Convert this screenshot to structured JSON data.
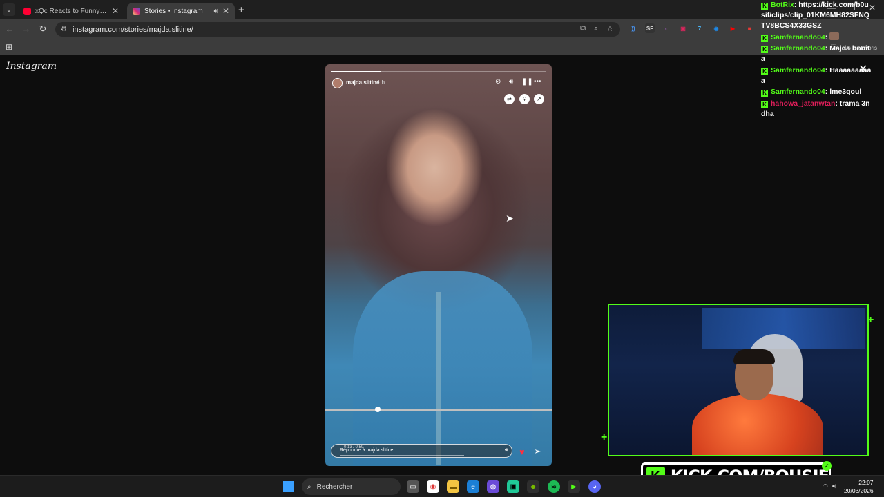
{
  "browser": {
    "tabs": [
      {
        "title": "xQc Reacts to Funny TikToks fo",
        "favicon_color": "#ff0033",
        "active": false
      },
      {
        "title": "Stories • Instagram",
        "favicon_color": "#d62976",
        "active": true
      }
    ],
    "url": "instagram.com/stories/majda.slitine/",
    "bookmarks_folder": "Tous les favoris",
    "extensions": [
      {
        "glyph": "))",
        "color": "#4a9bff"
      },
      {
        "glyph": "SF",
        "color": "#333333"
      },
      {
        "glyph": "◐",
        "color": "#9b59b6"
      },
      {
        "glyph": "▣",
        "color": "#e0245e"
      },
      {
        "glyph": "7",
        "color": "#4ab3f4"
      },
      {
        "glyph": "◉",
        "color": "#1e88e5"
      },
      {
        "glyph": "▶",
        "color": "#ff0000"
      },
      {
        "glyph": "■",
        "color": "#e53935"
      }
    ]
  },
  "instagram": {
    "logo_text": "Instagram",
    "story": {
      "username": "majda.slitine",
      "age": "1 h",
      "reply_placeholder": "Répondre à majda.slitine...",
      "timer": "0:13 / 0:59",
      "progress": 0.23
    }
  },
  "chat": {
    "messages": [
      {
        "user": "BotRix",
        "text": "https://kick.com/b0usif/clips/clip_01KM6MH82SFNQTV8BCS4X33GSZ",
        "user_color": "green"
      },
      {
        "user": "Samfernando04",
        "text": "",
        "user_color": "green"
      },
      {
        "user": "Samfernando04",
        "text": "Majda bonita",
        "user_color": "green"
      },
      {
        "user": "Samfernando04",
        "text": "Haaaaaaaaaa",
        "user_color": "green"
      },
      {
        "user": "Samfernando04",
        "text": "lme3qoul",
        "user_color": "green"
      },
      {
        "user": "hahowa_jatanwtan",
        "text": "trama 3ndha",
        "user_color": "red"
      }
    ]
  },
  "stream": {
    "banner_text": "KICK.COM/BOUSIF",
    "accent_color": "#53fc18"
  },
  "taskbar": {
    "search_placeholder": "Rechercher",
    "time": "22:07",
    "date": "20/03/2026"
  }
}
